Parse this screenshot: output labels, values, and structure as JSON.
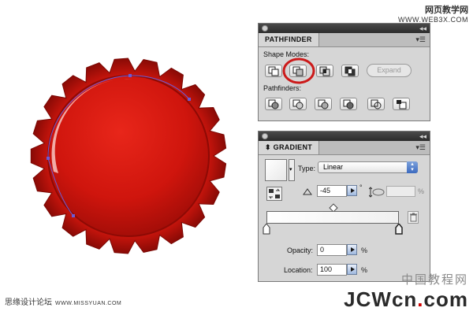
{
  "watermark_top": {
    "cn": "网页教学网",
    "url": "WWW.WEB3X.COM"
  },
  "pathfinder": {
    "tab": "PATHFINDER",
    "shape_modes_label": "Shape Modes:",
    "pathfinders_label": "Pathfinders:",
    "expand_label": "Expand",
    "highlighted_mode": "minus-front",
    "highlight_color": "#cc1a1a"
  },
  "gradient": {
    "tab": "GRADIENT",
    "type_label": "Type:",
    "type_value": "Linear",
    "angle_value": "-45",
    "angle_unit": "°",
    "aspect_unit": "%",
    "opacity_label": "Opacity:",
    "opacity_value": "0",
    "location_label": "Location:",
    "location_value": "100",
    "percent": "%"
  },
  "bottle_cap": {
    "color": "#d0150d",
    "path_color": "#6b5bd6"
  },
  "footer_left": {
    "cn": "思缘设计论坛",
    "url": "WWW.MISSYUAN.COM"
  },
  "brand": {
    "cn": "中国教程网",
    "text_main": "JCWcn",
    "text_dot": ".",
    "text_tail": "com"
  }
}
